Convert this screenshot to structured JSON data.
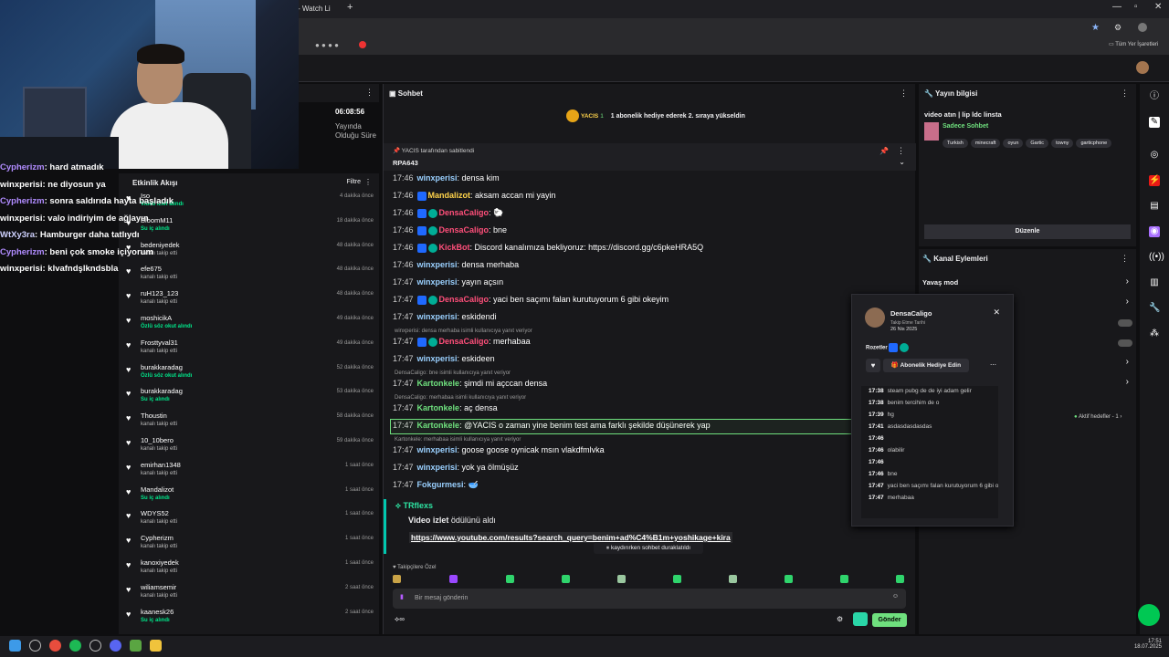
{
  "browser": {
    "tab_label": "- Watch Li",
    "bookmarks_label": "Tüm Yer İşaretleri"
  },
  "overlay_chat": [
    {
      "user": "Cypherizm",
      "text": "hard atmadık",
      "color": "#b18cff"
    },
    {
      "user": "winxperisi",
      "text": "ne diyosun ya",
      "color": "#ffffff"
    },
    {
      "user": "Cypherizm",
      "text": "sonra saldırıda hayta başladık",
      "color": "#b18cff"
    },
    {
      "user": "winxperisi",
      "text": "valo indiriyim de ağlayın",
      "color": "#ffffff"
    },
    {
      "user": "WtXy3ra",
      "text": "Hamburger daha tatlıydı",
      "color": "#cfd2ff"
    },
    {
      "user": "Cypherizm",
      "text": "beni çok smoke içiyorum",
      "color": "#b18cff"
    },
    {
      "user": "winxperisi",
      "text": "klvafndşlkndsbla",
      "color": "#ffffff"
    }
  ],
  "uptime": {
    "value": "06:08:56",
    "label": "Yayında Olduğu Süre"
  },
  "activity": {
    "title": "Etkinlik Akışı",
    "filter": "Filtre",
    "items": [
      {
        "name": "Iso",
        "sub": "Video izlet alındı",
        "green": true,
        "time": "4 dakika önce"
      },
      {
        "name": "BloomM11",
        "sub": "Su iç alındı",
        "green": true,
        "time": "18 dakika önce"
      },
      {
        "name": "bedeniyedek",
        "sub": "kanalı takip etti",
        "green": false,
        "time": "48 dakika önce"
      },
      {
        "name": "efe675",
        "sub": "kanalı takip etti",
        "green": false,
        "time": "48 dakika önce"
      },
      {
        "name": "ruH123_123",
        "sub": "kanalı takip etti",
        "green": false,
        "time": "48 dakika önce"
      },
      {
        "name": "moshicikA",
        "sub": "Özlü söz okut alındı",
        "green": true,
        "time": "49 dakika önce"
      },
      {
        "name": "Frosttyval31",
        "sub": "kanalı takip etti",
        "green": false,
        "time": "49 dakika önce"
      },
      {
        "name": "burakkaradag",
        "sub": "Özlü söz okut alındı",
        "green": true,
        "time": "52 dakika önce"
      },
      {
        "name": "burakkaradag",
        "sub": "Su iç alındı",
        "green": true,
        "time": "53 dakika önce"
      },
      {
        "name": "Thoustin",
        "sub": "kanalı takip etti",
        "green": false,
        "time": "58 dakika önce"
      },
      {
        "name": "10_10bero",
        "sub": "kanalı takip etti",
        "green": false,
        "time": "59 dakika önce"
      },
      {
        "name": "emirhan1348",
        "sub": "kanalı takip etti",
        "green": false,
        "time": "1 saat önce"
      },
      {
        "name": "Mandalizot",
        "sub": "Su iç alındı",
        "green": true,
        "time": "1 saat önce"
      },
      {
        "name": "WDYS52",
        "sub": "kanalı takip etti",
        "green": false,
        "time": "1 saat önce"
      },
      {
        "name": "Cypherizm",
        "sub": "kanalı takip etti",
        "green": false,
        "time": "1 saat önce"
      },
      {
        "name": "kanoxiyedek",
        "sub": "kanalı takip etti",
        "green": false,
        "time": "1 saat önce"
      },
      {
        "name": "wiliamsemir",
        "sub": "kanalı takip etti",
        "green": false,
        "time": "2 saat önce"
      },
      {
        "name": "kaanesk26",
        "sub": "Su iç alındı",
        "green": true,
        "time": "2 saat önce"
      }
    ]
  },
  "chat": {
    "title": "Sohbet",
    "hype_user": "YACIS",
    "hype_count": "1",
    "hype_text": "1 abonelik hediye ederek 2. sıraya yükseldin",
    "pinned_by": "YACIS tarafından sabitlendi",
    "pinned_text": "RPA643",
    "messages": [
      {
        "ts": "17:46",
        "user": "winxperisi",
        "cls": "u-blue",
        "text": ": densa kim",
        "badges": 0
      },
      {
        "ts": "17:46",
        "user": "Mandalizot",
        "cls": "u-yel",
        "text": ": aksam accan mi yayin",
        "badges": 1
      },
      {
        "ts": "17:46",
        "user": "DensaCaligo",
        "cls": "u-red",
        "text": ": 🐑",
        "badges": 2
      },
      {
        "ts": "17:46",
        "user": "DensaCaligo",
        "cls": "u-red",
        "text": ": bne",
        "badges": 2
      },
      {
        "ts": "17:46",
        "user": "KickBot",
        "cls": "u-red",
        "text": ": Discord kanalımıza bekliyoruz: https://discord.gg/c6pkeHRA5Q",
        "badges": 2
      },
      {
        "ts": "17:46",
        "user": "winxperisi",
        "cls": "u-blue",
        "text": ": densa merhaba",
        "badges": 0
      },
      {
        "ts": "17:47",
        "user": "winxperisi",
        "cls": "u-blue",
        "text": ": yayın açsın",
        "badges": 0
      },
      {
        "ts": "17:47",
        "user": "DensaCaligo",
        "cls": "u-red",
        "text": ": yaci ben saçımı falan kurutuyorum 6 gibi okeyim",
        "badges": 2
      },
      {
        "ts": "17:47",
        "user": "winxperisi",
        "cls": "u-blue",
        "text": ": eskidendi",
        "badges": 0
      },
      {
        "ts": "17:47",
        "user": "DensaCaligo",
        "cls": "u-red",
        "text": ": merhabaa",
        "badges": 2
      },
      {
        "ts": "17:47",
        "user": "winxperisi",
        "cls": "u-blue",
        "text": ": eskideen",
        "badges": 0
      },
      {
        "ts": "17:47",
        "user": "Kartonkele",
        "cls": "u-grn",
        "text": ": şimdi mi açccan densa",
        "badges": 0
      },
      {
        "ts": "17:47",
        "user": "Kartonkele",
        "cls": "u-grn",
        "text": ": aç densa",
        "badges": 0
      },
      {
        "ts": "17:47",
        "user": "Kartonkele",
        "cls": "u-grn",
        "text": ": @YACIS o zaman yine benim test ama farklı şekilde düşünerek yap",
        "badges": 0
      },
      {
        "ts": "17:47",
        "user": "winxperisi",
        "cls": "u-blue",
        "text": ": goose goose oynicak msın vlakdfmlvka",
        "badges": 0
      },
      {
        "ts": "17:47",
        "user": "winxperisi",
        "cls": "u-blue",
        "text": ": yok ya ölmüşüz",
        "badges": 0
      },
      {
        "ts": "17:47",
        "user": "Fokgurmesi",
        "cls": "u-blue",
        "text": ": 🥣",
        "badges": 0
      }
    ],
    "replies": [
      "winxperisi: densa merhaba isimli kullanıcıya yanıt veriyor",
      "DensaCaligo: bne isimli kullanıcıya yanıt veriyor",
      "DensaCaligo: merhabaa isimli kullanıcıya yanıt veriyor",
      "Kartonkele: merhabaa isimli kullanıcıya yanıt veriyor"
    ],
    "redeem": {
      "user": "TRflexs",
      "title": "Video izlet",
      "suffix": "ödülünü aldı",
      "link": "https://www.youtube.com/results?search_query=benim+ad%C4%B1m+yoshikage+kira"
    },
    "pause_label": "kaydırırken sohbet duraklatıldı",
    "followers_only": "Takipçilere Özel",
    "input_placeholder": "Bir mesaj gönderin",
    "send_label": "Gönder"
  },
  "stream_info": {
    "title": "Yayın bilgisi",
    "stream_title": "video atın | lip ldc linsta",
    "category": "Sadece Sohbet",
    "tags": [
      "Turkish",
      "minecraft",
      "oyun",
      "Gartic",
      "towny",
      "garticphone"
    ],
    "edit_label": "Düzenle"
  },
  "channel_actions": {
    "title": "Kanal Eylemleri",
    "slow_mode": "Yavaş mod",
    "active_goals": "Aktif hedefler - 1"
  },
  "user_card": {
    "name": "DensaCaligo",
    "follow_label": "Takip Etme Tarihi",
    "follow_date": "26 Nis 2025",
    "badges_label": "Rozetler",
    "gift_label": "Abonelik Hediye Edin",
    "history": [
      {
        "ts": "17:38",
        "text": "steam pubg de de iyi adam gelir"
      },
      {
        "ts": "17:38",
        "text": "benim tercihim de o"
      },
      {
        "ts": "17:39",
        "text": "hg"
      },
      {
        "ts": "17:41",
        "text": "asdasdasdasdas"
      },
      {
        "ts": "17:46",
        "text": ""
      },
      {
        "ts": "17:46",
        "text": "olabilir"
      },
      {
        "ts": "17:46",
        "text": ""
      },
      {
        "ts": "17:46",
        "text": "bne"
      },
      {
        "ts": "17:47",
        "text": "yaci ben saçımı falan kurutuyorum 6 gibi okeyim"
      },
      {
        "ts": "17:47",
        "text": "merhabaa"
      }
    ]
  },
  "taskbar": {
    "time": "17:51",
    "date": "18.07.2025"
  }
}
